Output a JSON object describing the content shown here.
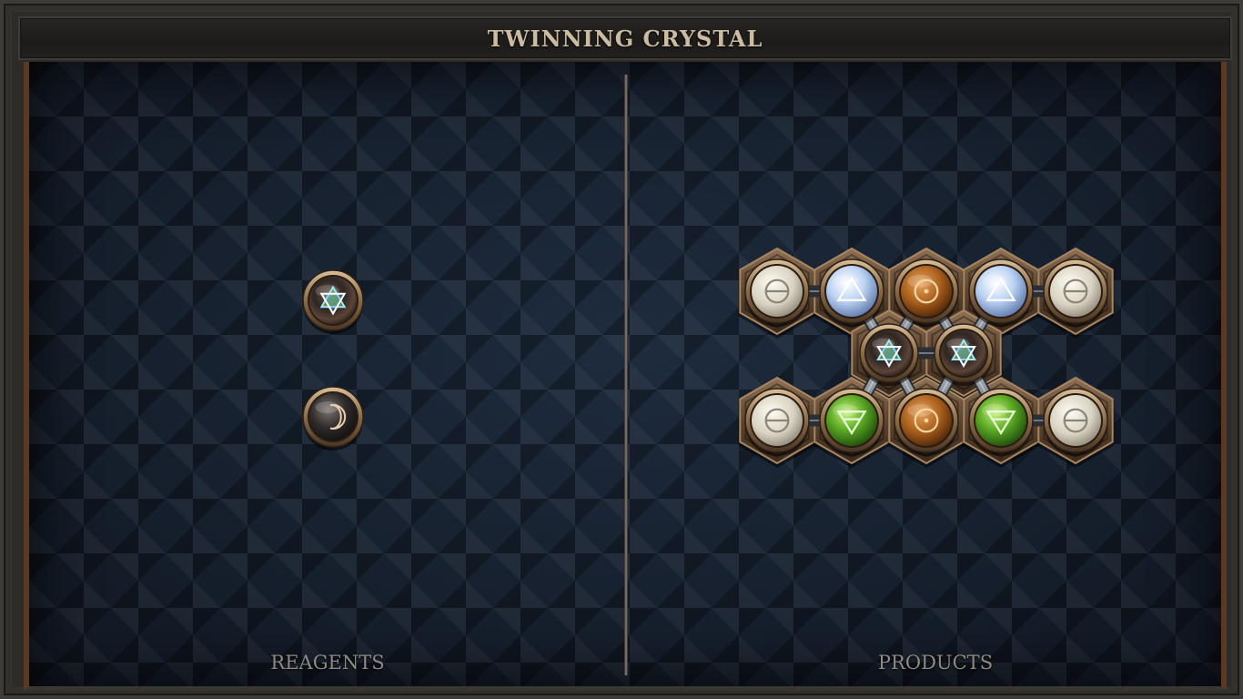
{
  "title": "TWINNING CRYSTAL",
  "panels": {
    "reagents_label": "REAGENTS",
    "products_label": "PRODUCTS"
  },
  "colors": {
    "salt": "#e4dfd0",
    "water": "#c6dbf7",
    "fire": "#c97a2c",
    "earth": "#6fbf34",
    "quintessence": "#3c2a1e",
    "vitae_glyph": "#9fe6ff",
    "frame_gold": "#a88661",
    "label_text": "#8e8a85",
    "title_text": "#cbbba1"
  },
  "reagents": [
    {
      "element": "quintessence",
      "glyph": "hexagram-icon"
    },
    {
      "element": "mors",
      "glyph": "crescent-moon-icon"
    }
  ],
  "product": {
    "atoms": [
      {
        "element": "salt",
        "glyph": "salt-icon"
      },
      {
        "element": "water",
        "glyph": "water-triangle-icon"
      },
      {
        "element": "fire",
        "glyph": "sun-icon"
      },
      {
        "element": "water",
        "glyph": "water-triangle-icon"
      },
      {
        "element": "salt",
        "glyph": "salt-icon"
      },
      {
        "element": "quintessence",
        "glyph": "hexagram-icon"
      },
      {
        "element": "quintessence",
        "glyph": "hexagram-icon"
      },
      {
        "element": "salt",
        "glyph": "salt-icon"
      },
      {
        "element": "earth",
        "glyph": "earth-triangle-icon"
      },
      {
        "element": "fire",
        "glyph": "sun-icon"
      },
      {
        "element": "earth",
        "glyph": "earth-triangle-icon"
      },
      {
        "element": "salt",
        "glyph": "salt-icon"
      }
    ],
    "bonds": [
      [
        0,
        1
      ],
      [
        1,
        5
      ],
      [
        2,
        5
      ],
      [
        2,
        6
      ],
      [
        3,
        6
      ],
      [
        3,
        4
      ],
      [
        5,
        6
      ],
      [
        5,
        8
      ],
      [
        5,
        9
      ],
      [
        6,
        9
      ],
      [
        6,
        10
      ],
      [
        7,
        8
      ],
      [
        10,
        11
      ]
    ]
  }
}
